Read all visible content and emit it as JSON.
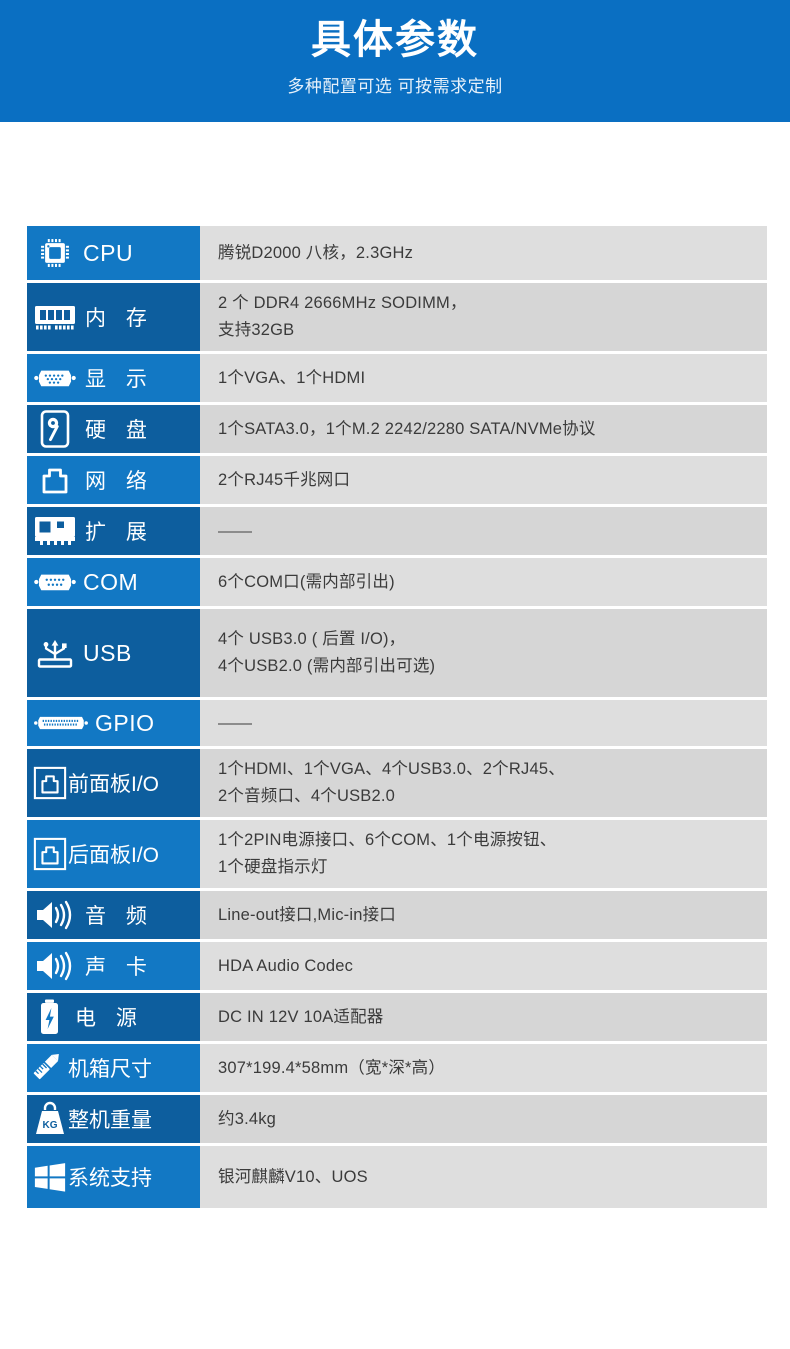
{
  "header": {
    "title": "具体参数",
    "subtitle": "多种配置可选 可按需求定制",
    "bg_color": "#0a6fc2"
  },
  "colors": {
    "label_light": "#1278c4",
    "label_dark": "#0d5e9e",
    "value_light": "#dedede",
    "value_dark": "#d6d6d6",
    "value_text": "#3b3b3b"
  },
  "spec_table": {
    "rows": [
      {
        "icon": "cpu-chip-icon",
        "label": "CPU",
        "lines": [
          "腾锐D2000 八核，2.3GHz"
        ]
      },
      {
        "icon": "memory-module-icon",
        "label": "内 存",
        "lines": [
          "2 个 DDR4 2666MHz SODIMM，",
          "支持32GB"
        ]
      },
      {
        "icon": "vga-port-icon",
        "label": "显 示",
        "lines": [
          "1个VGA、1个HDMI"
        ]
      },
      {
        "icon": "hard-disk-icon",
        "label": "硬 盘",
        "lines": [
          "1个SATA3.0，1个M.2 2242/2280 SATA/NVMe协议"
        ]
      },
      {
        "icon": "rj45-network-icon",
        "label": "网 络",
        "lines": [
          "2个RJ45千兆网口"
        ]
      },
      {
        "icon": "expansion-card-icon",
        "label": "扩 展",
        "lines": [
          "——"
        ]
      },
      {
        "icon": "com-serial-port-icon",
        "label": "COM",
        "lines": [
          "6个COM口(需内部引出)"
        ]
      },
      {
        "icon": "usb-icon",
        "label": "USB",
        "lines": [
          "4个 USB3.0 ( 后置 I/O)，",
          "4个USB2.0 (需内部引出可选)"
        ]
      },
      {
        "icon": "gpio-connector-icon",
        "label": "GPIO",
        "lines": [
          "——"
        ]
      },
      {
        "icon": "front-panel-io-icon",
        "label": "前面板I/O",
        "lines": [
          "1个HDMI、1个VGA、4个USB3.0、2个RJ45、",
          "2个音频口、4个USB2.0"
        ]
      },
      {
        "icon": "rear-panel-io-icon",
        "label": "后面板I/O",
        "lines": [
          "1个2PIN电源接口、6个COM、1个电源按钮、",
          "1个硬盘指示灯"
        ]
      },
      {
        "icon": "speaker-audio-icon",
        "label": "音 频",
        "lines": [
          "Line-out接口,Mic-in接口"
        ]
      },
      {
        "icon": "speaker-soundcard-icon",
        "label": "声 卡",
        "lines": [
          "HDA Audio Codec"
        ]
      },
      {
        "icon": "battery-power-icon",
        "label": "电 源",
        "lines": [
          "DC IN 12V 10A适配器"
        ]
      },
      {
        "icon": "ruler-pencil-icon",
        "label": "机箱尺寸",
        "lines": [
          "307*199.4*58mm（宽*深*高）"
        ]
      },
      {
        "icon": "weight-kg-icon",
        "label": "整机重量",
        "lines": [
          "约3.4kg"
        ]
      },
      {
        "icon": "windows-logo-icon",
        "label": "系统支持",
        "lines": [
          "银河麒麟V10、UOS"
        ]
      }
    ]
  }
}
